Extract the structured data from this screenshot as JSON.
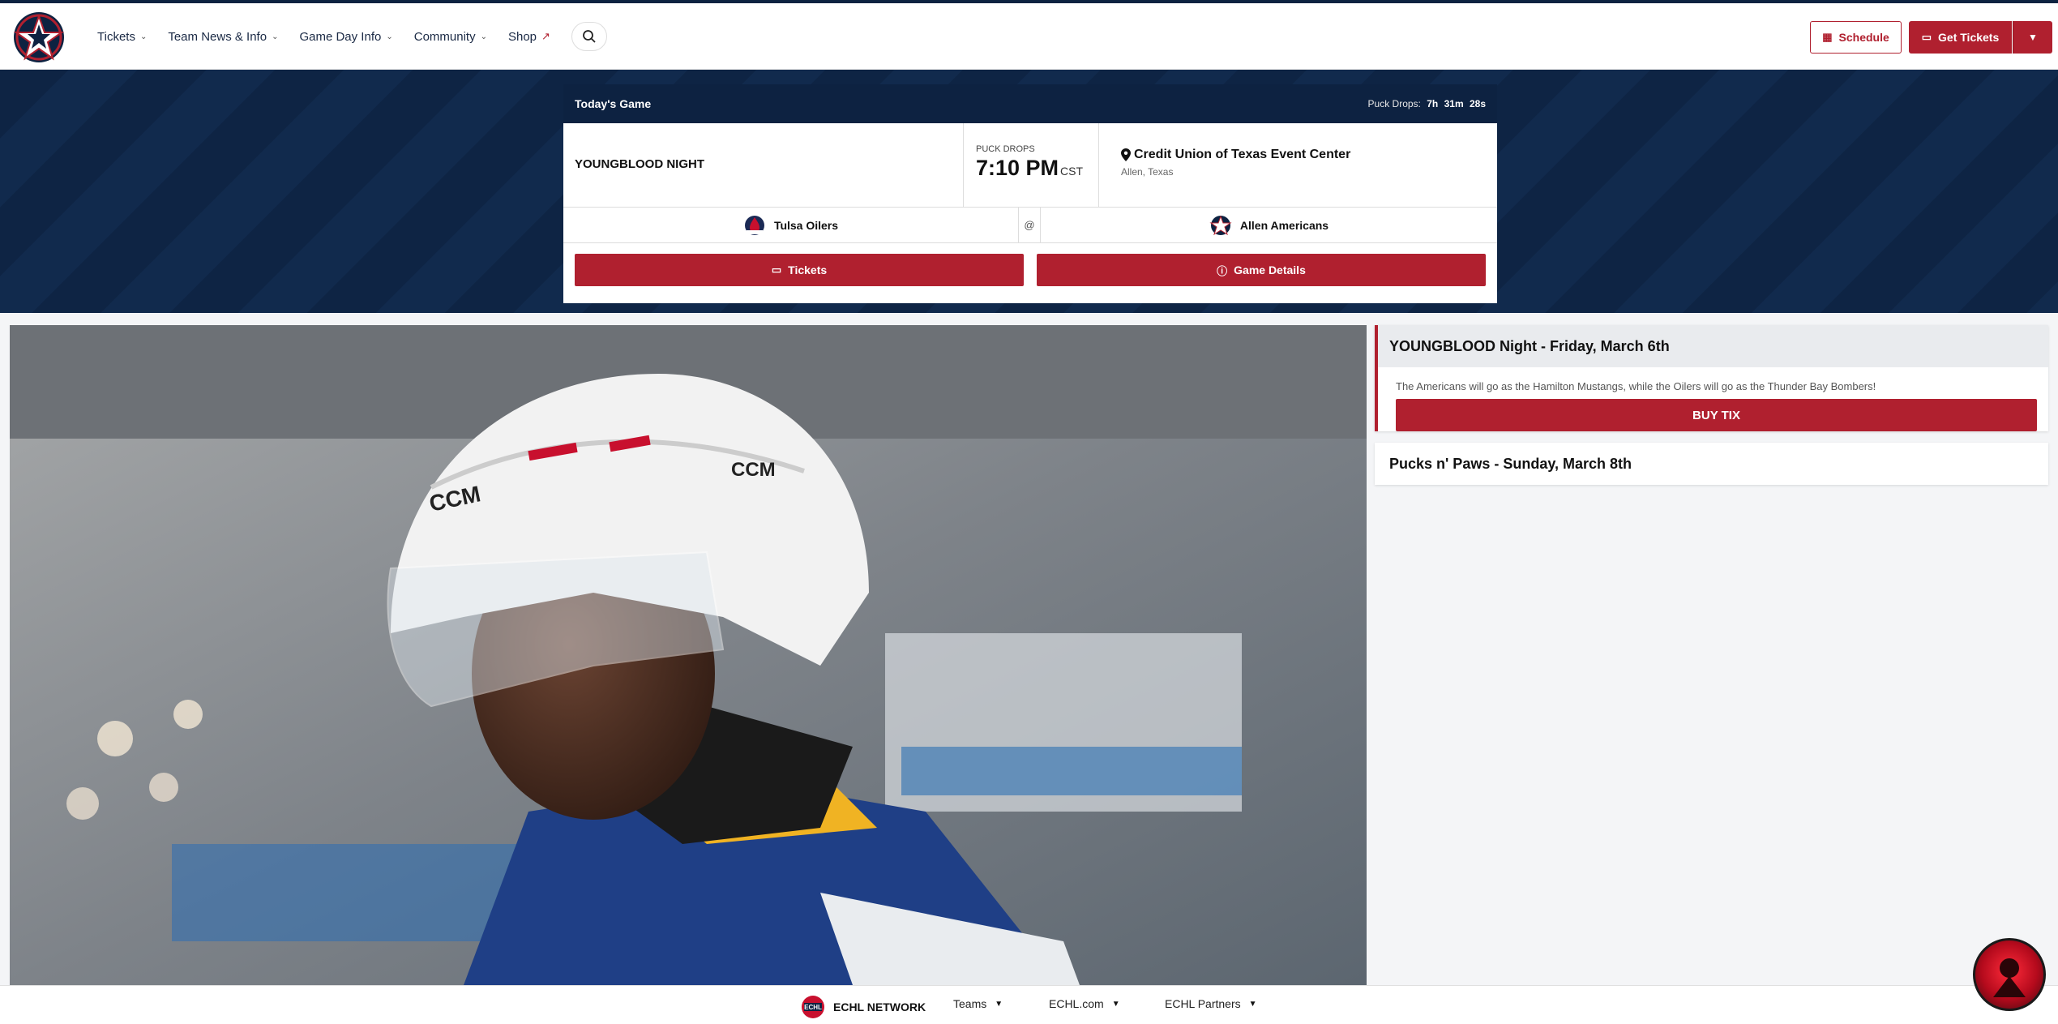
{
  "header": {
    "nav": [
      {
        "label": "Tickets"
      },
      {
        "label": "Team News & Info"
      },
      {
        "label": "Game Day Info"
      },
      {
        "label": "Community"
      },
      {
        "label": "Shop"
      }
    ],
    "schedule_label": "Schedule",
    "get_tickets_label": "Get Tickets"
  },
  "todays_game": {
    "title": "Today's Game",
    "puck_drops_label": "Puck Drops:",
    "countdown": {
      "h": "7h",
      "m": "31m",
      "s": "28s"
    },
    "event_name": "YOUNGBLOOD NIGHT",
    "puck_drop_caption": "PUCK DROPS",
    "time": "7:10 PM",
    "timezone": "CST",
    "venue": "Credit Union of Texas Event Center",
    "location": "Allen, Texas",
    "away_team": "Tulsa Oilers",
    "at": "@",
    "home_team": "Allen Americans",
    "tickets_label": "Tickets",
    "details_label": "Game Details"
  },
  "promos": [
    {
      "title": "YOUNGBLOOD Night - Friday, March 6th",
      "description": "The Americans will go as the Hamilton Mustangs, while the Oilers will go as the Thunder Bay Bombers!",
      "cta": "BUY TIX"
    },
    {
      "title": "Pucks n' Paws - Sunday, March 8th"
    }
  ],
  "footer_bar": {
    "network": "ECHL NETWORK",
    "items": [
      {
        "label": "Teams"
      },
      {
        "label": "ECHL.com"
      },
      {
        "label": "ECHL Partners"
      }
    ]
  },
  "colors": {
    "brand_red": "#b0202f",
    "navy": "#0d2241"
  }
}
